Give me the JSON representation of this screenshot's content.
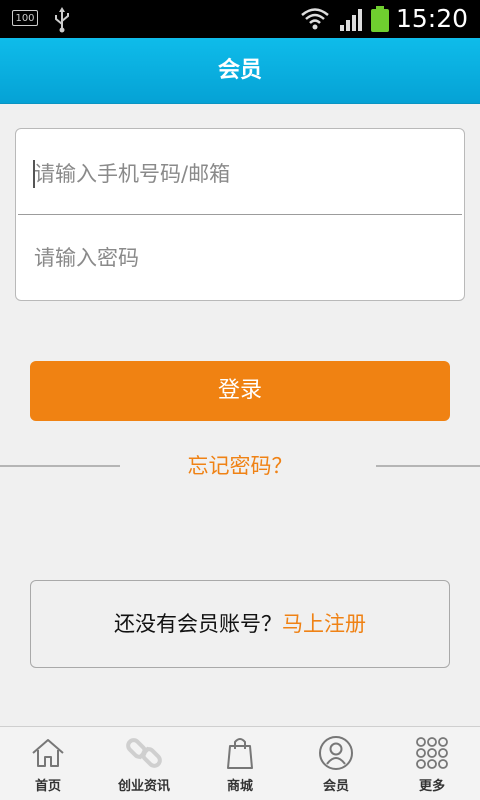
{
  "status_bar": {
    "battery_level_text": "100",
    "time": "15:20",
    "icons": [
      "battery-text-icon",
      "usb-icon",
      "wifi-icon",
      "signal-icon",
      "battery-icon"
    ]
  },
  "header": {
    "title": "会员"
  },
  "login_form": {
    "phone_placeholder": "请输入手机号码/邮箱",
    "password_placeholder": "请输入密码"
  },
  "login_button": {
    "label": "登录"
  },
  "forgot_password": {
    "label": "忘记密码？"
  },
  "register": {
    "prompt": "还没有会员账号？",
    "link": "马上注册"
  },
  "bottom_nav": {
    "items": [
      {
        "label": "首页",
        "icon": "home-icon"
      },
      {
        "label": "创业资讯",
        "icon": "link-icon"
      },
      {
        "label": "商城",
        "icon": "shopping-bag-icon"
      },
      {
        "label": "会员",
        "icon": "user-icon"
      },
      {
        "label": "更多",
        "icon": "grid-icon"
      }
    ]
  },
  "colors": {
    "header": "#05a2d5",
    "accent": "#f08212",
    "background": "#f0f0f0"
  }
}
